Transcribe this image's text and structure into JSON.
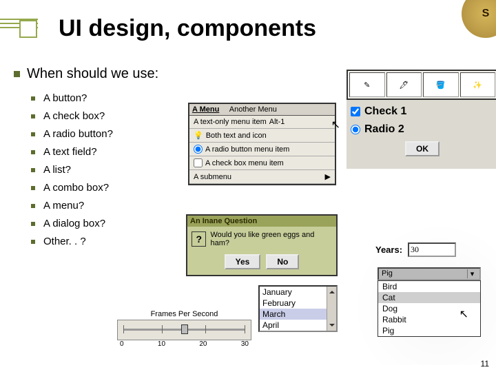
{
  "title": "UI design, components",
  "subtitle": "When should we use:",
  "bullets": [
    "A button?",
    "A check box?",
    "A radio button?",
    "A text field?",
    "A list?",
    "A combo box?",
    "A menu?",
    "A dialog box?",
    "Other. . ?"
  ],
  "badge": "S",
  "page_number": "11",
  "menu": {
    "headers": [
      "A Menu",
      "Another Menu"
    ],
    "items": [
      {
        "label": "A text-only menu item",
        "accel": "Alt-1"
      },
      {
        "label": "Both text and icon",
        "icon": "lightbulb"
      },
      {
        "label": "A radio button menu item",
        "radio": true
      },
      {
        "label": "A check box menu item",
        "check": true
      },
      {
        "label": "A submenu",
        "submenu": true
      }
    ]
  },
  "dialog": {
    "title": "An Inane Question",
    "message": "Would you like green eggs and ham?",
    "buttons": [
      "Yes",
      "No"
    ]
  },
  "right": {
    "check_label": "Check 1",
    "radio_label": "Radio 2",
    "ok": "OK"
  },
  "years": {
    "label": "Years:",
    "value": "30"
  },
  "list": {
    "items": [
      "January",
      "February",
      "March",
      "April"
    ],
    "selected": "March"
  },
  "combo": {
    "selected": "Pig",
    "options": [
      "Bird",
      "Cat",
      "Dog",
      "Rabbit",
      "Pig"
    ],
    "highlighted": "Cat"
  },
  "slider": {
    "label": "Frames Per Second",
    "ticks": [
      "0",
      "10",
      "20",
      "30"
    ],
    "value": 15,
    "min": 0,
    "max": 30
  }
}
